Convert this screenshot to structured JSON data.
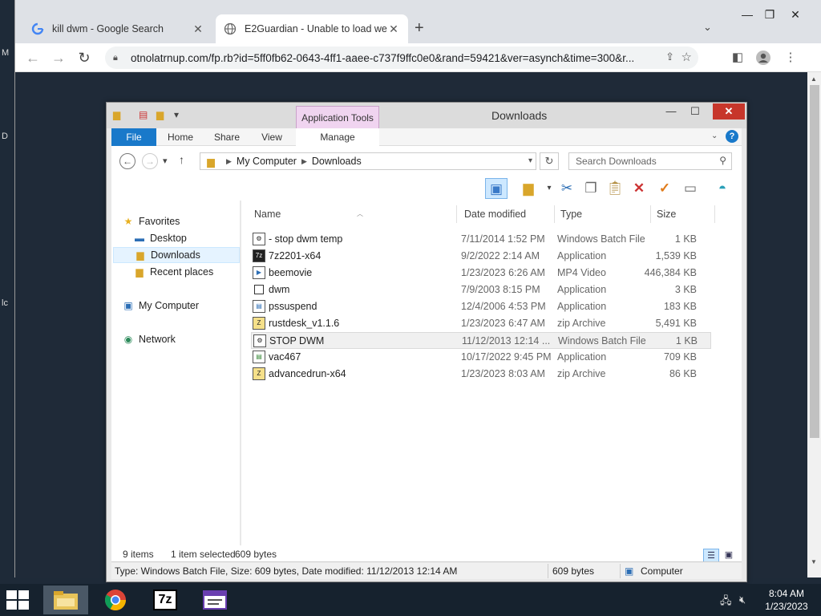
{
  "desktop": {
    "edge_labels": [
      "M",
      "D",
      "lc"
    ]
  },
  "browser": {
    "tabs": [
      {
        "title": "kill dwm - Google Search",
        "icon": "google-g-icon"
      },
      {
        "title": "E2Guardian - Unable to load web",
        "icon": "globe-icon"
      }
    ],
    "new_tab": "+",
    "url": "otnolatrnup.com/fp.rb?id=5ff0fb62-0643-4ff1-aaee-c737f9ffc0e0&rand=59421&ver=asynch&time=300&r..."
  },
  "explorer": {
    "title": "Downloads",
    "context_tab": "Application Tools",
    "ribbon_tabs": [
      "File",
      "Home",
      "Share",
      "View",
      "Manage"
    ],
    "breadcrumb": [
      "My Computer",
      "Downloads"
    ],
    "search_placeholder": "Search Downloads",
    "nav": {
      "favorites": "Favorites",
      "desktop": "Desktop",
      "downloads": "Downloads",
      "recent": "Recent places",
      "computer": "My Computer",
      "network": "Network"
    },
    "columns": {
      "name": "Name",
      "date": "Date modified",
      "type": "Type",
      "size": "Size"
    },
    "files": [
      {
        "name": "- stop dwm temp",
        "date": "7/11/2014 1:52 PM",
        "type": "Windows Batch File",
        "size": "1 KB",
        "icon": "batch-file-icon",
        "selected": false
      },
      {
        "name": "7z2201-x64",
        "date": "9/2/2022 2:14 AM",
        "type": "Application",
        "size": "1,539 KB",
        "icon": "7zip-app-icon",
        "selected": false
      },
      {
        "name": "beemovie",
        "date": "1/23/2023 6:26 AM",
        "type": "MP4 Video",
        "size": "446,384 KB",
        "icon": "video-file-icon",
        "selected": false
      },
      {
        "name": "dwm",
        "date": "7/9/2003 8:15 PM",
        "type": "Application",
        "size": "3 KB",
        "icon": "blank-app-icon",
        "selected": false
      },
      {
        "name": "pssuspend",
        "date": "12/4/2006 4:53 PM",
        "type": "Application",
        "size": "183 KB",
        "icon": "app-window-icon",
        "selected": false
      },
      {
        "name": "rustdesk_v1.1.6",
        "date": "1/23/2023 6:47 AM",
        "type": "zip Archive",
        "size": "5,491 KB",
        "icon": "zip-archive-icon",
        "selected": false
      },
      {
        "name": "STOP DWM",
        "date": "11/12/2013 12:14 ...",
        "type": "Windows Batch File",
        "size": "1 KB",
        "icon": "batch-file-icon",
        "selected": true
      },
      {
        "name": "vac467",
        "date": "10/17/2022 9:45 PM",
        "type": "Application",
        "size": "709 KB",
        "icon": "app-window-icon",
        "selected": false
      },
      {
        "name": "advancedrun-x64",
        "date": "1/23/2023 8:03 AM",
        "type": "zip Archive",
        "size": "86 KB",
        "icon": "zip-archive-icon",
        "selected": false
      }
    ],
    "status": {
      "count": "9 items",
      "selection": "1 item selected",
      "bytes": "609 bytes"
    },
    "details": {
      "info": "Type: Windows Batch File, Size: 609 bytes, Date modified: 11/12/2013 12:14 AM",
      "size": "609 bytes",
      "location": "Computer"
    }
  },
  "taskbar": {
    "apps": [
      "file-explorer-icon",
      "chrome-icon",
      "7zip-icon",
      "window-app-icon"
    ],
    "sevenzip_label": "7z",
    "time": "8:04 AM",
    "date": "1/23/2023"
  },
  "colors": {
    "file_tab": "#1979ca",
    "close_button": "#c7362b",
    "context_tab": "#f0d4f0",
    "taskbar": "#16222e"
  }
}
